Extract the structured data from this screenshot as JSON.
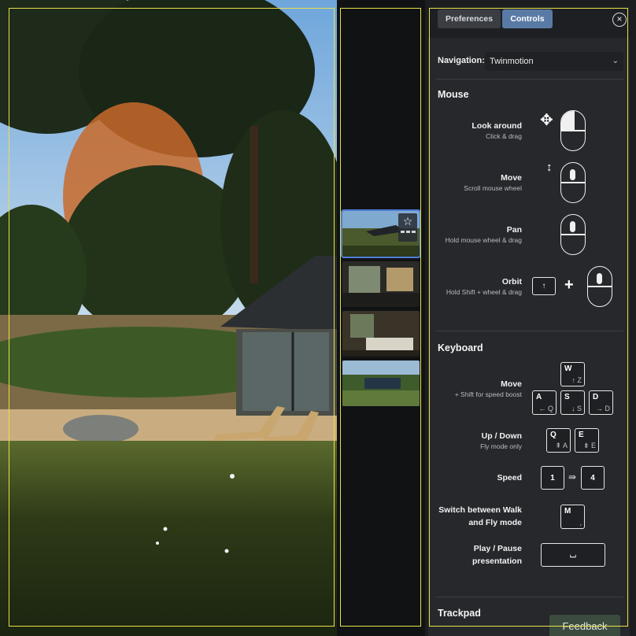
{
  "tabs": [
    {
      "label": "Preferences",
      "active": false
    },
    {
      "label": "Controls",
      "active": true
    }
  ],
  "close_icon": "close-icon",
  "navigation": {
    "label": "Navigation:",
    "value": "Twinmotion"
  },
  "mouse": {
    "title": "Mouse",
    "rows": [
      {
        "title": "Look around",
        "sub": "Click & drag"
      },
      {
        "title": "Move",
        "sub": "Scroll mouse wheel"
      },
      {
        "title": "Pan",
        "sub": "Hold mouse wheel & drag"
      },
      {
        "title": "Orbit",
        "sub": "Hold Shift + wheel & drag"
      }
    ],
    "orbit_key": "↑",
    "plus": "+"
  },
  "keyboard": {
    "title": "Keyboard",
    "move": {
      "title": "Move",
      "sub": "+ Shift for speed boost"
    },
    "keys_move": [
      {
        "main": "W",
        "alt": "↑ Z"
      },
      {
        "main": "A",
        "alt": "← Q"
      },
      {
        "main": "S",
        "alt": "↓ S"
      },
      {
        "main": "D",
        "alt": "→ D"
      }
    ],
    "updown": {
      "title": "Up / Down",
      "sub": "Fly mode only"
    },
    "keys_updown": [
      {
        "main": "Q",
        "alt": "⇞ A"
      },
      {
        "main": "E",
        "alt": "⇟ E"
      }
    ],
    "speed": {
      "title": "Speed",
      "from": "1",
      "to": "4",
      "arrow": "⇛"
    },
    "switch": {
      "title1": "Switch between Walk",
      "title2": "and Fly mode",
      "key": "M",
      "key_alt": ","
    },
    "play": {
      "title1": "Play / Pause",
      "title2": "presentation",
      "key": "⌴"
    }
  },
  "trackpad": {
    "title": "Trackpad"
  },
  "feedback_label": "Feedback",
  "colors": {
    "accent": "#5a7aa6",
    "selection": "#4f7bd9",
    "frame": "#e8e04a"
  }
}
